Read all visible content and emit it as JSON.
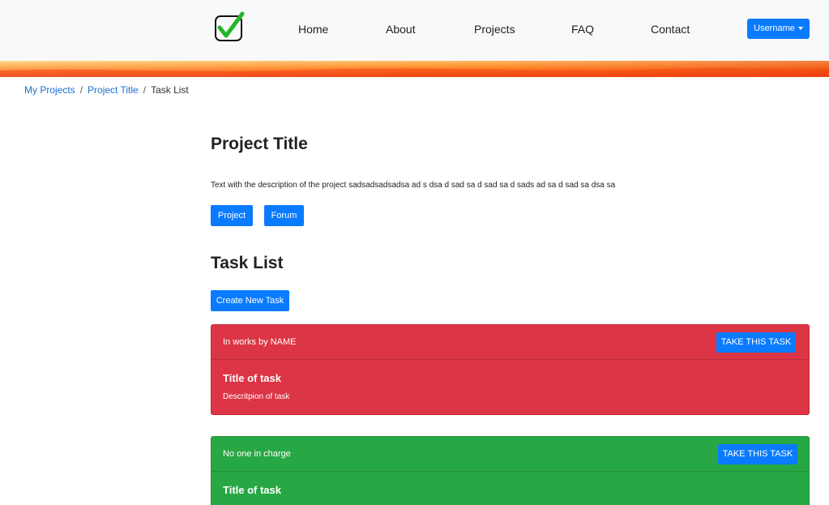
{
  "navbar": {
    "logo_icon": "checkbox-checkmark-icon",
    "items": [
      {
        "label": "Home"
      },
      {
        "label": "About"
      },
      {
        "label": "Projects"
      },
      {
        "label": "FAQ"
      },
      {
        "label": "Contact"
      }
    ],
    "user_button": "Username"
  },
  "breadcrumb": {
    "items": [
      "My Projects",
      "Project Title",
      "Task List"
    ],
    "separator": "/"
  },
  "project": {
    "title": "Project Title",
    "description": "Text with the description of the project sadsadsadsadsa ad s dsa d sad sa d sad sa d sads ad sa d sad sa dsa sa",
    "buttons": {
      "project": "Project",
      "forum": "Forum"
    }
  },
  "task_list": {
    "heading": "Task List",
    "create_button": "Create New Task",
    "tasks": [
      {
        "status": "In works by NAME",
        "action": "TAKE THIS TASK",
        "title": "Title of task",
        "description": "Descritpion of task",
        "color": "#dc3545"
      },
      {
        "status": "No one in charge",
        "action": "TAKE THIS TASK",
        "title": "Title of task",
        "color": "#28a745"
      }
    ]
  },
  "colors": {
    "primary": "#0a7bff",
    "danger": "#dc3545",
    "success": "#28a745",
    "link": "#1b6fd1",
    "navbar_bg": "#f8f9fa"
  }
}
